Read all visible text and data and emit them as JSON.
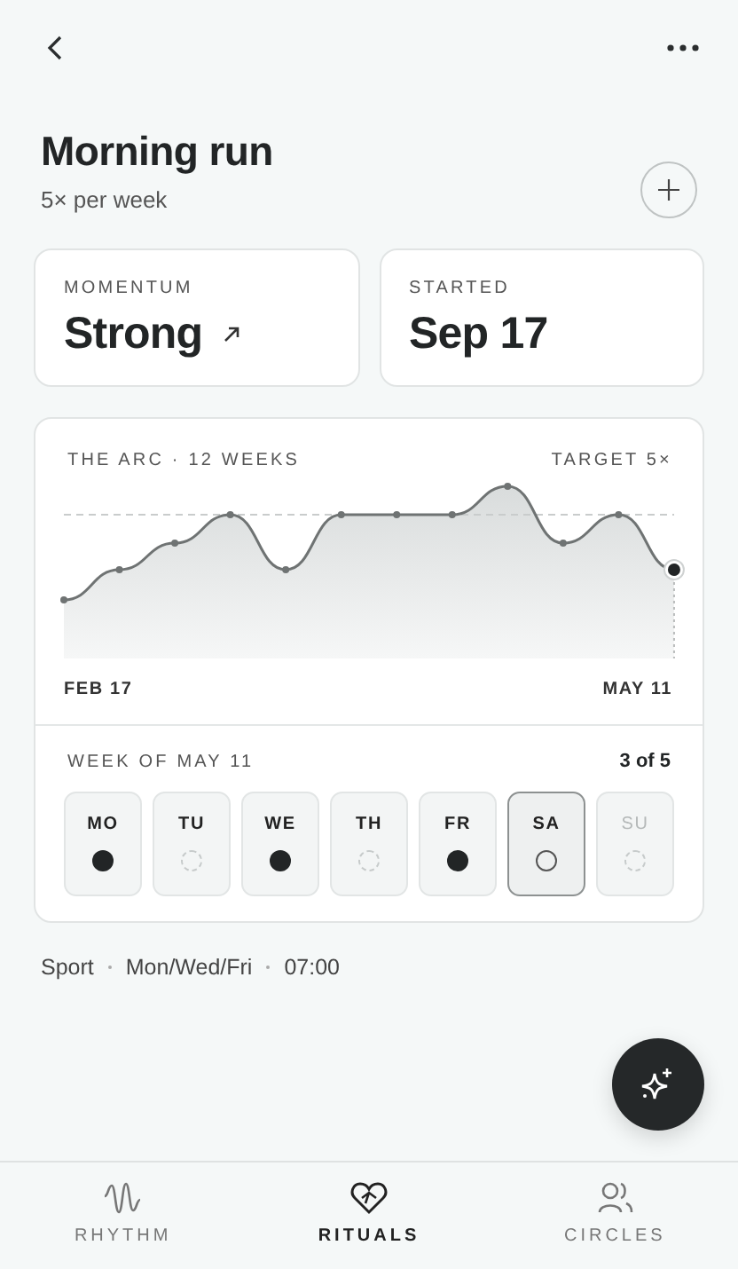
{
  "title": "Morning run",
  "subtitle": "5× per week",
  "stats": [
    {
      "label": "MOMENTUM",
      "value": "Strong",
      "kind": "rising"
    },
    {
      "label": "STARTED",
      "value": "Sep 17",
      "kind": "plain"
    }
  ],
  "arc": {
    "title": "THE ARC · 12 WEEKS",
    "target": "TARGET 5×",
    "start_label": "FEB 17",
    "end_label": "MAY 11"
  },
  "week": {
    "title": "WEEK OF MAY 11",
    "count": "3 of 5",
    "days": [
      {
        "label": "MO",
        "kind": "done",
        "selected": false
      },
      {
        "label": "TU",
        "kind": "missed",
        "selected": false
      },
      {
        "label": "WE",
        "kind": "done",
        "selected": false
      },
      {
        "label": "TH",
        "kind": "missed",
        "selected": false
      },
      {
        "label": "FR",
        "kind": "done",
        "selected": false
      },
      {
        "label": "SA",
        "kind": "today",
        "selected": true
      },
      {
        "label": "SU",
        "kind": "upcoming",
        "selected": false
      }
    ]
  },
  "meta": [
    "Sport",
    "Mon/Wed/Fri",
    "07:00"
  ],
  "nav": [
    {
      "label": "RHYTHM",
      "kind": "wave",
      "selected": false
    },
    {
      "label": "RITUALS",
      "kind": "heart",
      "selected": true
    },
    {
      "label": "CIRCLES",
      "kind": "people",
      "selected": false
    }
  ]
}
